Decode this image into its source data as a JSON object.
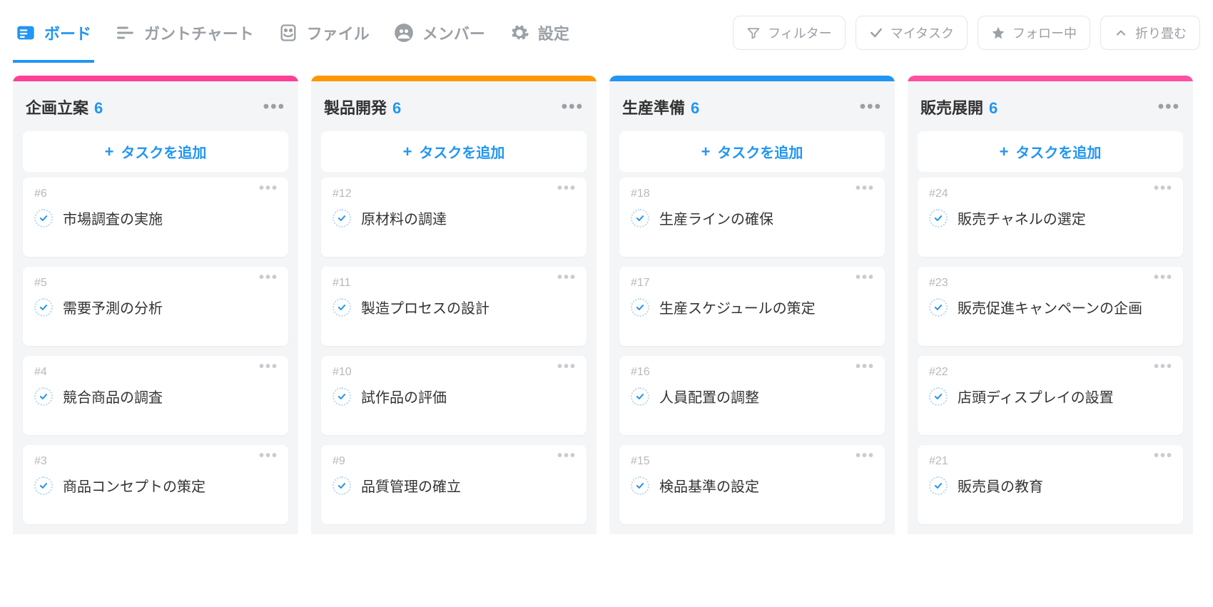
{
  "nav": {
    "tabs": [
      {
        "label": "ボード",
        "icon": "board-icon",
        "active": true
      },
      {
        "label": "ガントチャート",
        "icon": "gantt-icon",
        "active": false
      },
      {
        "label": "ファイル",
        "icon": "file-icon",
        "active": false
      },
      {
        "label": "メンバー",
        "icon": "members-icon",
        "active": false
      },
      {
        "label": "設定",
        "icon": "settings-icon",
        "active": false
      }
    ],
    "actions": [
      {
        "label": "フィルター",
        "icon": "filter-icon"
      },
      {
        "label": "マイタスク",
        "icon": "check-icon"
      },
      {
        "label": "フォロー中",
        "icon": "star-icon"
      },
      {
        "label": "折り畳む",
        "icon": "collapse-icon"
      }
    ]
  },
  "addTaskLabel": "タスクを追加",
  "columns": [
    {
      "title": "企画立案",
      "count": "6",
      "stripe": "stripe-pink",
      "cards": [
        {
          "id": "#6",
          "title": "市場調査の実施"
        },
        {
          "id": "#5",
          "title": "需要予測の分析"
        },
        {
          "id": "#4",
          "title": "競合商品の調査"
        },
        {
          "id": "#3",
          "title": "商品コンセプトの策定"
        }
      ]
    },
    {
      "title": "製品開発",
      "count": "6",
      "stripe": "stripe-orange",
      "cards": [
        {
          "id": "#12",
          "title": "原材料の調達"
        },
        {
          "id": "#11",
          "title": "製造プロセスの設計"
        },
        {
          "id": "#10",
          "title": "試作品の評価"
        },
        {
          "id": "#9",
          "title": "品質管理の確立"
        }
      ]
    },
    {
      "title": "生産準備",
      "count": "6",
      "stripe": "stripe-blue",
      "cards": [
        {
          "id": "#18",
          "title": "生産ラインの確保"
        },
        {
          "id": "#17",
          "title": "生産スケジュールの策定"
        },
        {
          "id": "#16",
          "title": "人員配置の調整"
        },
        {
          "id": "#15",
          "title": "検品基準の設定"
        }
      ]
    },
    {
      "title": "販売展開",
      "count": "6",
      "stripe": "stripe-pink2",
      "cards": [
        {
          "id": "#24",
          "title": "販売チャネルの選定"
        },
        {
          "id": "#23",
          "title": "販売促進キャンペーンの企画"
        },
        {
          "id": "#22",
          "title": "店頭ディスプレイの設置"
        },
        {
          "id": "#21",
          "title": "販売員の教育"
        }
      ]
    }
  ]
}
